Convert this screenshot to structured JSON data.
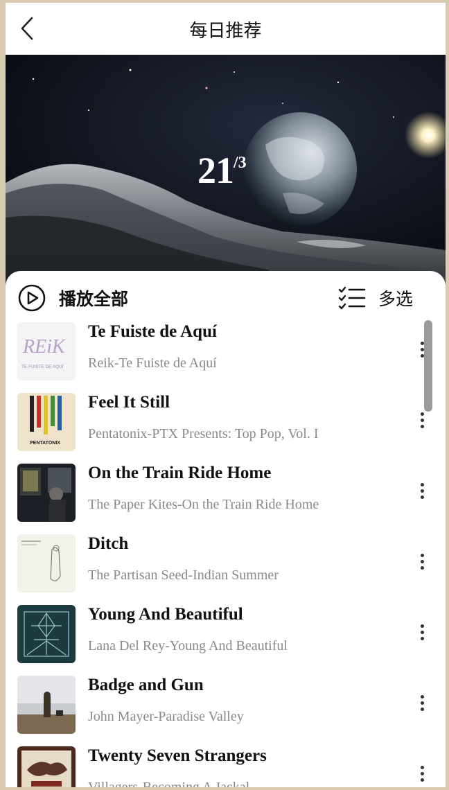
{
  "header": {
    "title": "每日推荐"
  },
  "banner": {
    "day": "21",
    "month": "/3"
  },
  "toolbar": {
    "play_all_label": "播放全部",
    "multi_select_label": "多选"
  },
  "songs": [
    {
      "title": "Te Fuiste de Aquí",
      "subtitle": "Reik-Te Fuiste de Aquí"
    },
    {
      "title": "Feel It Still",
      "subtitle": "Pentatonix-PTX Presents: Top Pop, Vol. I"
    },
    {
      "title": "On the Train Ride Home",
      "subtitle": "The Paper Kites-On the Train Ride Home"
    },
    {
      "title": "Ditch",
      "subtitle": "The Partisan Seed-Indian Summer"
    },
    {
      "title": "Young And Beautiful",
      "subtitle": "Lana Del Rey-Young And Beautiful"
    },
    {
      "title": "Badge and Gun",
      "subtitle": "John Mayer-Paradise Valley"
    },
    {
      "title": "Twenty Seven Strangers",
      "subtitle": "Villagers-Becoming A Jackal"
    }
  ],
  "covers": {
    "c0": {
      "text": "REiK",
      "subtext": "TE FUISTE DE AQUÍ"
    },
    "c1": {
      "text": "PENTATONIX"
    }
  },
  "icons": {
    "back": "chevron-left-icon",
    "play": "play-circle-icon",
    "multi": "checklist-icon",
    "more": "more-vertical-icon"
  },
  "colors": {
    "accent_text": "#111111",
    "secondary_text": "#8a8a8a",
    "outer_frame": "#d9ccb0"
  }
}
